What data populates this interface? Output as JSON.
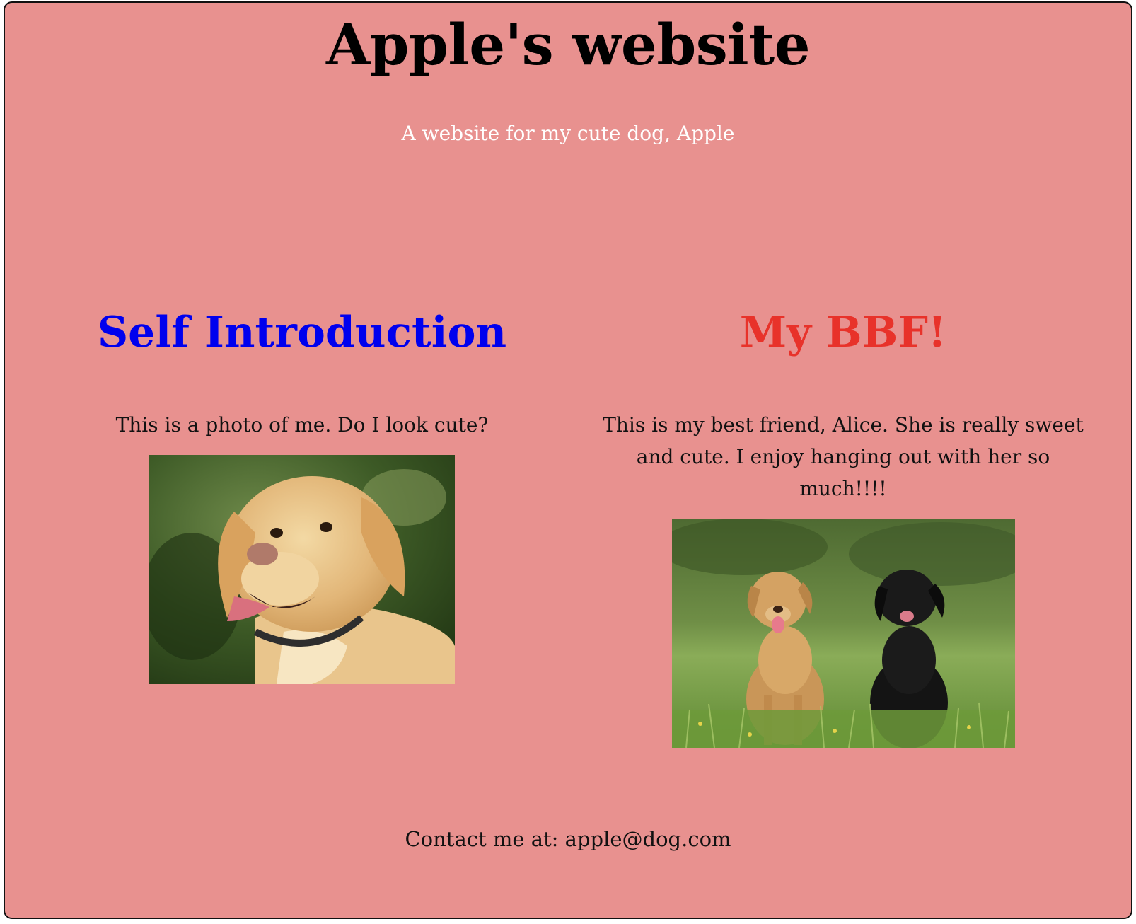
{
  "header": {
    "title": "Apple's website",
    "subtitle": "A website for my cute dog, Apple"
  },
  "sections": [
    {
      "title": "Self Introduction",
      "title_color": "#0000ee",
      "text": "This is a photo of me. Do I look cute?",
      "image": "golden-labrador-photo"
    },
    {
      "title": "My BBF!",
      "title_color": "#e8322a",
      "text": "This is my best friend, Alice. She is really sweet and cute. I enjoy hanging out with her so much!!!!",
      "image": "two-dogs-in-grass-photo"
    }
  ],
  "footer": {
    "contact": "Contact me at: apple@dog.com"
  },
  "colors": {
    "page_background": "#e8918f",
    "title_text": "#000000",
    "subtitle_text": "#ffffff"
  }
}
